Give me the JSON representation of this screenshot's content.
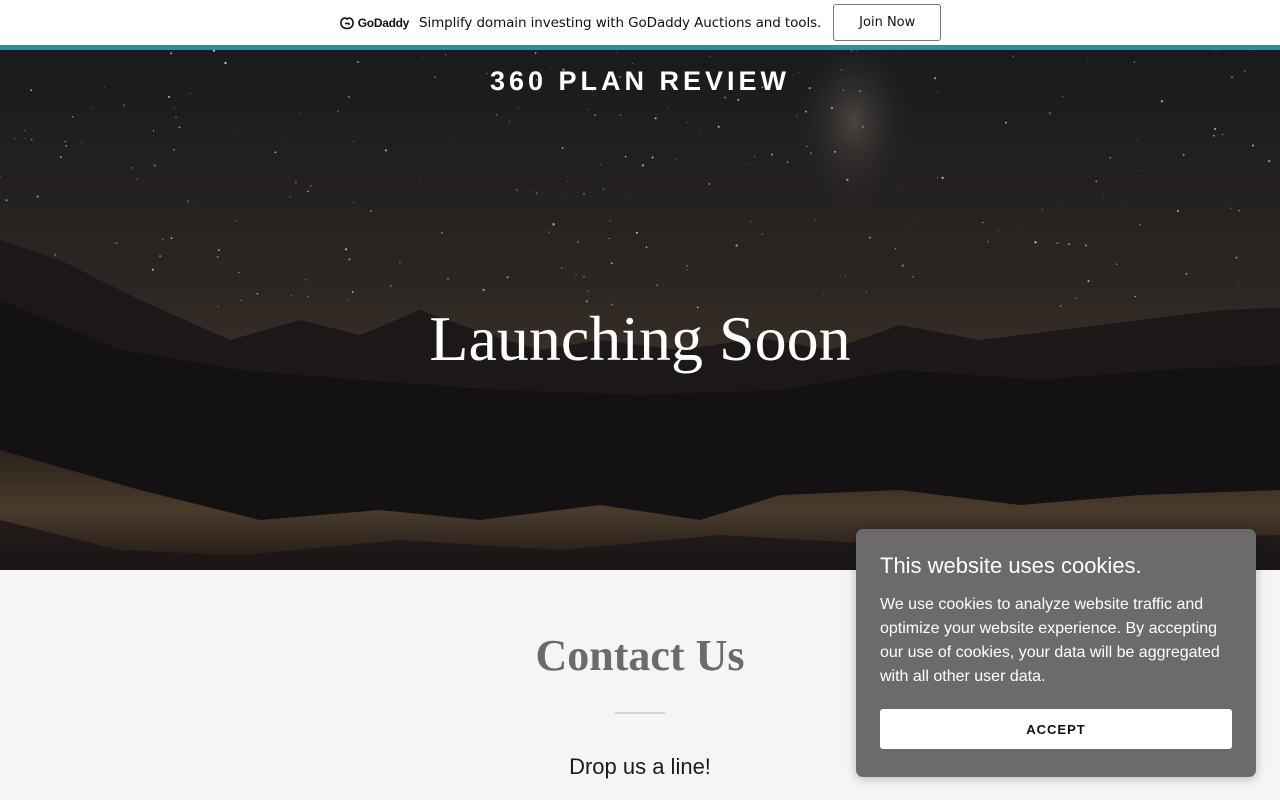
{
  "promo": {
    "brand": "GoDaddy",
    "message": "Simplify domain investing with GoDaddy Auctions and tools.",
    "cta": "Join Now",
    "accent_color": "#1b9b9a"
  },
  "hero": {
    "site_title": "360 PLAN REVIEW",
    "heading": "Launching Soon"
  },
  "contact": {
    "title": "Contact Us",
    "subtitle": "Drop us a line!"
  },
  "cookie_banner": {
    "title": "This website uses cookies.",
    "body": "We use cookies to analyze website traffic and optimize your website experience. By accepting our use of cookies, your data will be aggregated with all other user data.",
    "accept_label": "ACCEPT",
    "background_color": "#6b6b6b"
  },
  "icons": {
    "brand_logo": "godaddy-logo-icon"
  }
}
